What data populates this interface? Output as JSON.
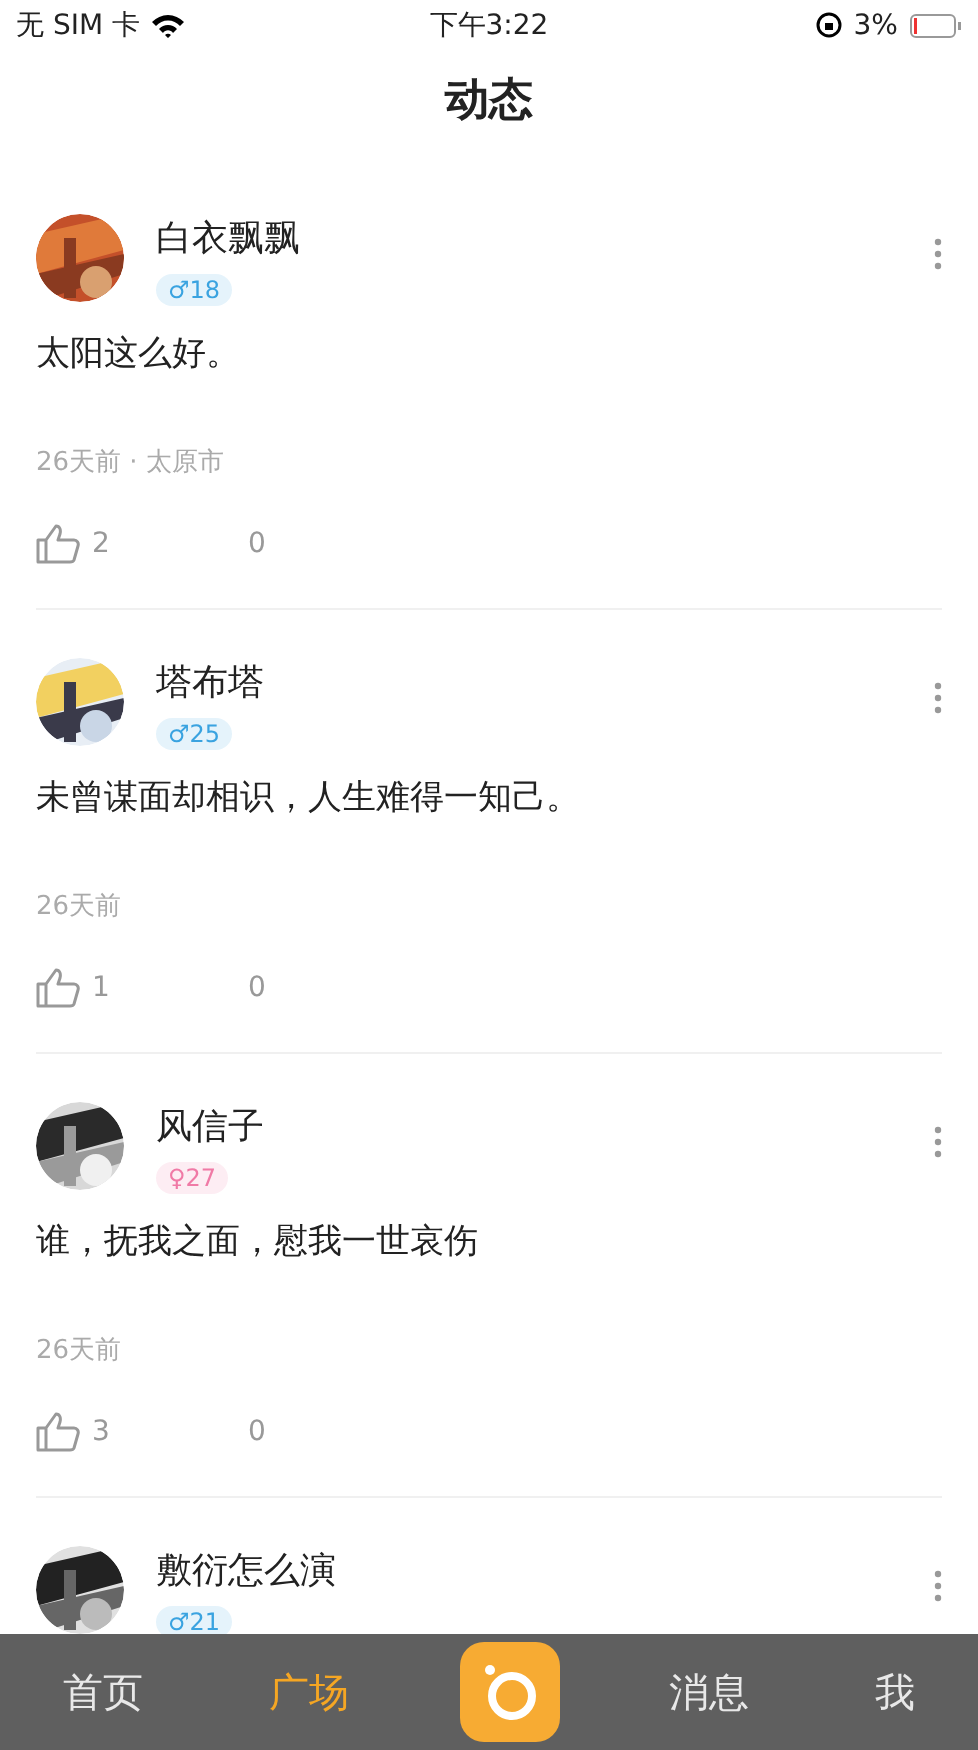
{
  "status_bar": {
    "carrier": "无 SIM 卡",
    "time": "下午3:22",
    "battery": "3%"
  },
  "title": "动态",
  "posts": [
    {
      "name": "白衣飘飘",
      "color": "#3aa3e0",
      "badge": "♂18",
      "text": "太阳这么好。",
      "meta": "26天前 · 太原市",
      "likes": "2",
      "comments": "0"
    },
    {
      "name": "塔布塔",
      "color": "#3aa3e0",
      "badge": "♂25",
      "text": "未曾谋面却相识，人生难得一知己。",
      "meta": "26天前",
      "likes": "1",
      "comments": "0"
    },
    {
      "name": "风信子",
      "color": "#f07aa6",
      "badge": "♀27",
      "text": "谁，抚我之面，慰我一世哀伤",
      "meta": "26天前",
      "likes": "3",
      "comments": "0"
    },
    {
      "name": "敷衍怎么演",
      "color": "#3aa3e0",
      "badge": "♂21"
    }
  ],
  "tabs": [
    {
      "label": "首页",
      "selected": false
    },
    {
      "label": "广场",
      "selected": true
    },
    {
      "kind": "camera"
    },
    {
      "label": "消息",
      "selected": false
    },
    {
      "label": "我",
      "selected": false
    }
  ]
}
